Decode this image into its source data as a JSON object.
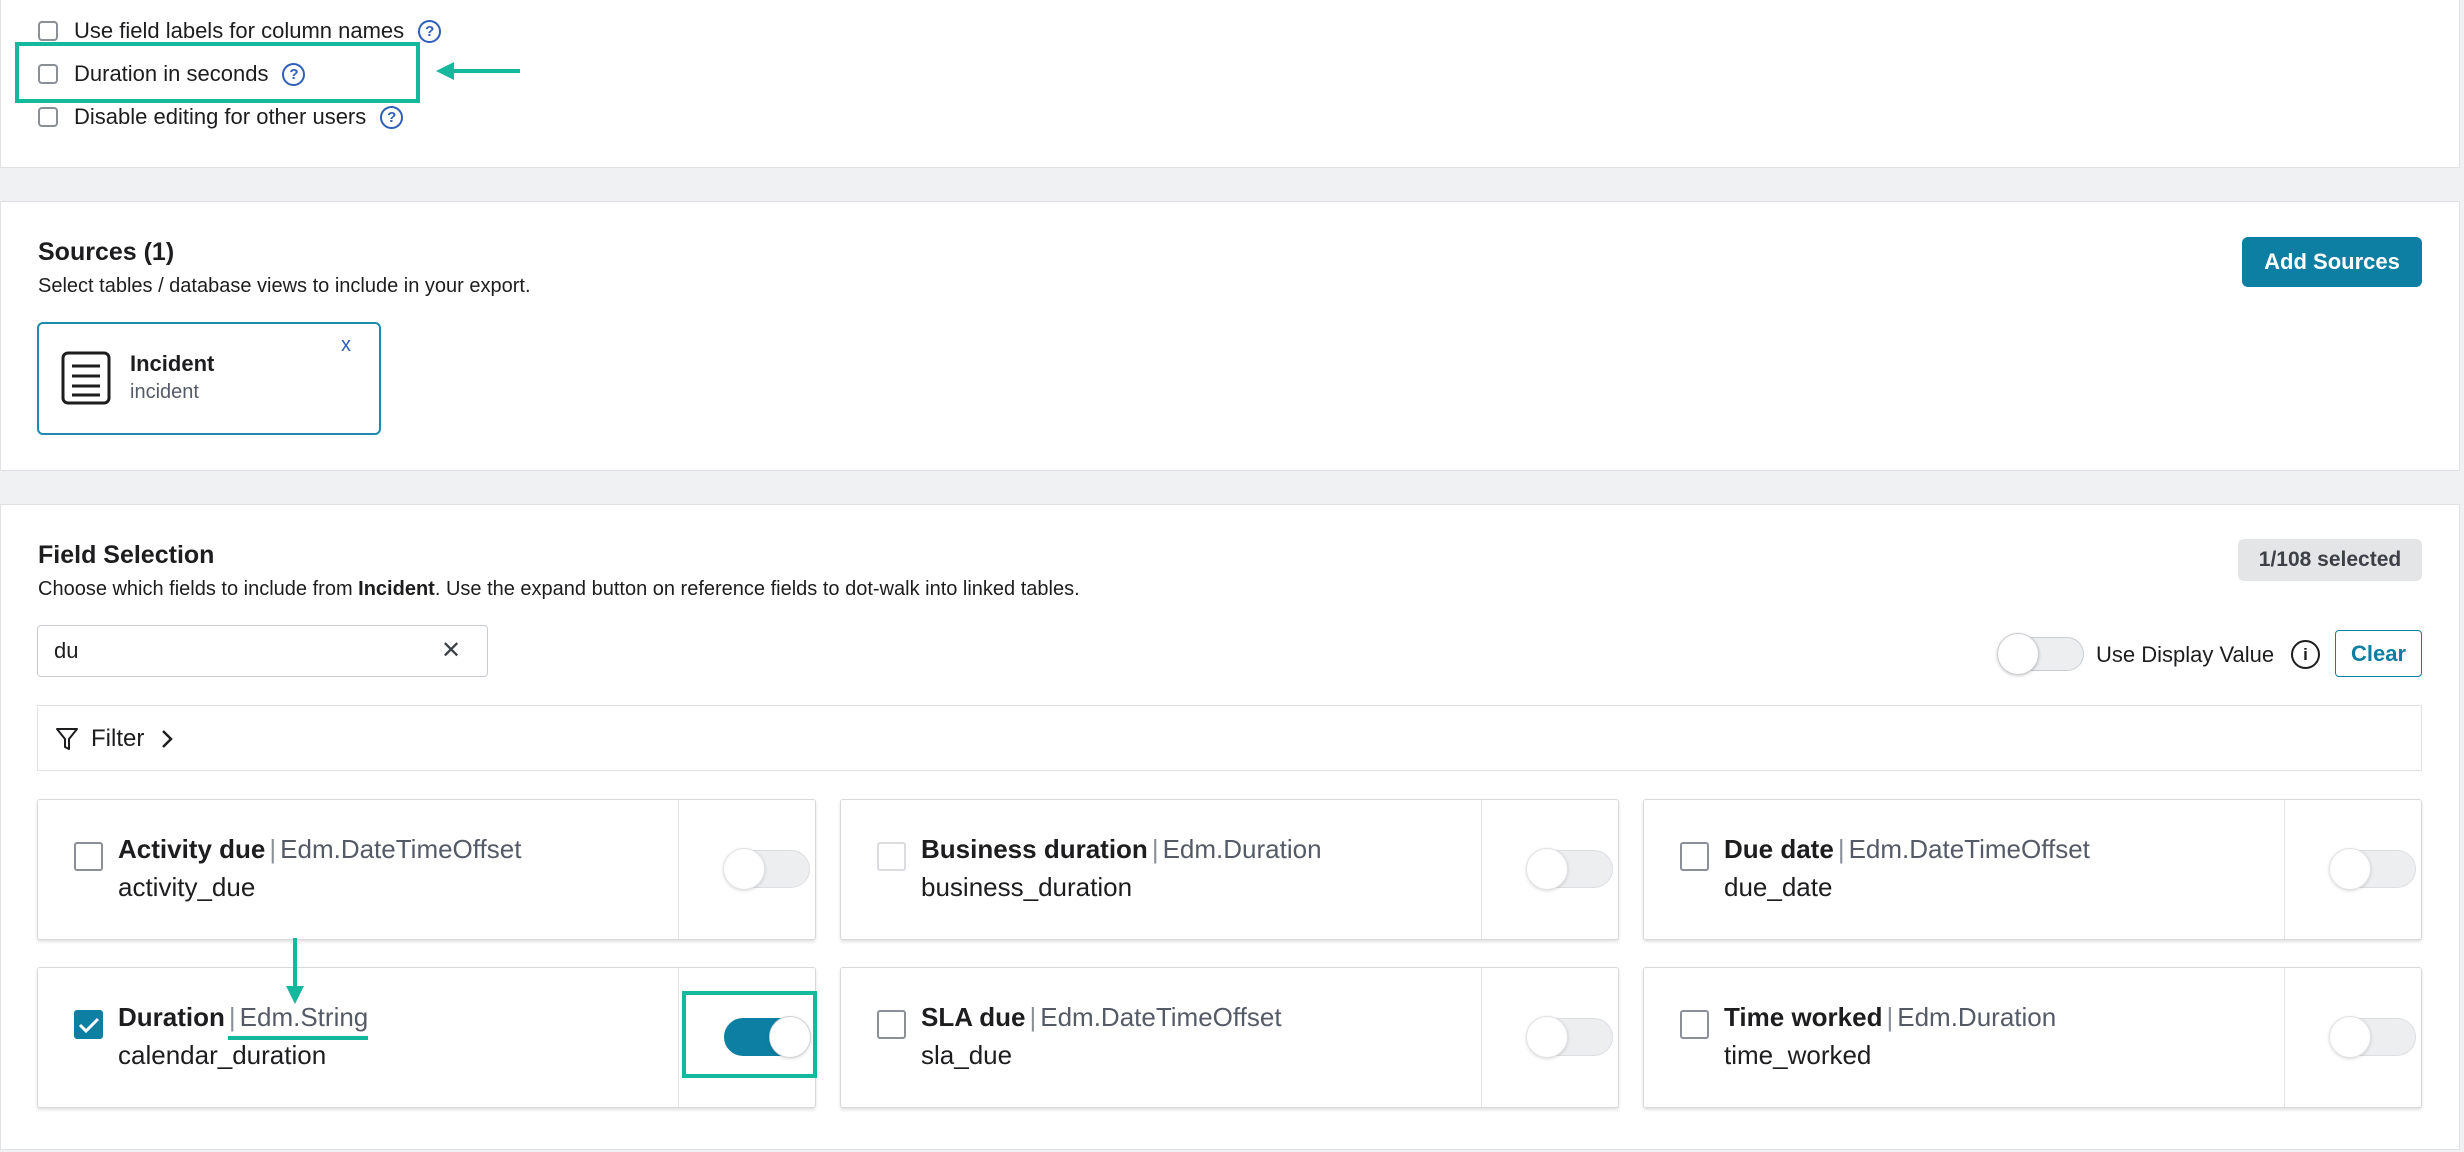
{
  "options": {
    "use_field_labels": "Use field labels for column names",
    "duration_in_seconds": "Duration in seconds",
    "disable_editing": "Disable editing for other users",
    "help_glyph": "?"
  },
  "sources": {
    "title": "Sources (1)",
    "description": "Select tables / database views to include in your export.",
    "add_button": "Add Sources",
    "items": [
      {
        "label": "Incident",
        "name": "incident",
        "remove": "x"
      }
    ]
  },
  "field_selection": {
    "title": "Field Selection",
    "description_prefix": "Choose which fields to include from ",
    "description_table": "Incident",
    "description_suffix": ". Use the expand button on reference fields to dot-walk into linked tables.",
    "selected_badge": "1/108 selected",
    "search_value": "du",
    "clear_glyph": "✕",
    "display_value_label": "Use Display Value",
    "info_glyph": "i",
    "clear_button": "Clear",
    "filter_label": "Filter",
    "separator": "|",
    "fields": [
      {
        "label": "Activity due",
        "type": "Edm.DateTimeOffset",
        "name": "activity_due",
        "checked": false,
        "display_value": false
      },
      {
        "label": "Business duration",
        "type": "Edm.Duration",
        "name": "business_duration",
        "checked": false,
        "display_value": false
      },
      {
        "label": "Due date",
        "type": "Edm.DateTimeOffset",
        "name": "due_date",
        "checked": false,
        "display_value": false
      },
      {
        "label": "Duration",
        "type": "Edm.String",
        "name": "calendar_duration",
        "checked": true,
        "display_value": true
      },
      {
        "label": "SLA due",
        "type": "Edm.DateTimeOffset",
        "name": "sla_due",
        "checked": false,
        "display_value": false
      },
      {
        "label": "Time worked",
        "type": "Edm.Duration",
        "name": "time_worked",
        "checked": false,
        "display_value": false
      }
    ]
  },
  "colors": {
    "accent": "#0d7fa3",
    "annotation": "#14b89c",
    "help_icon": "#2e5fb7"
  }
}
